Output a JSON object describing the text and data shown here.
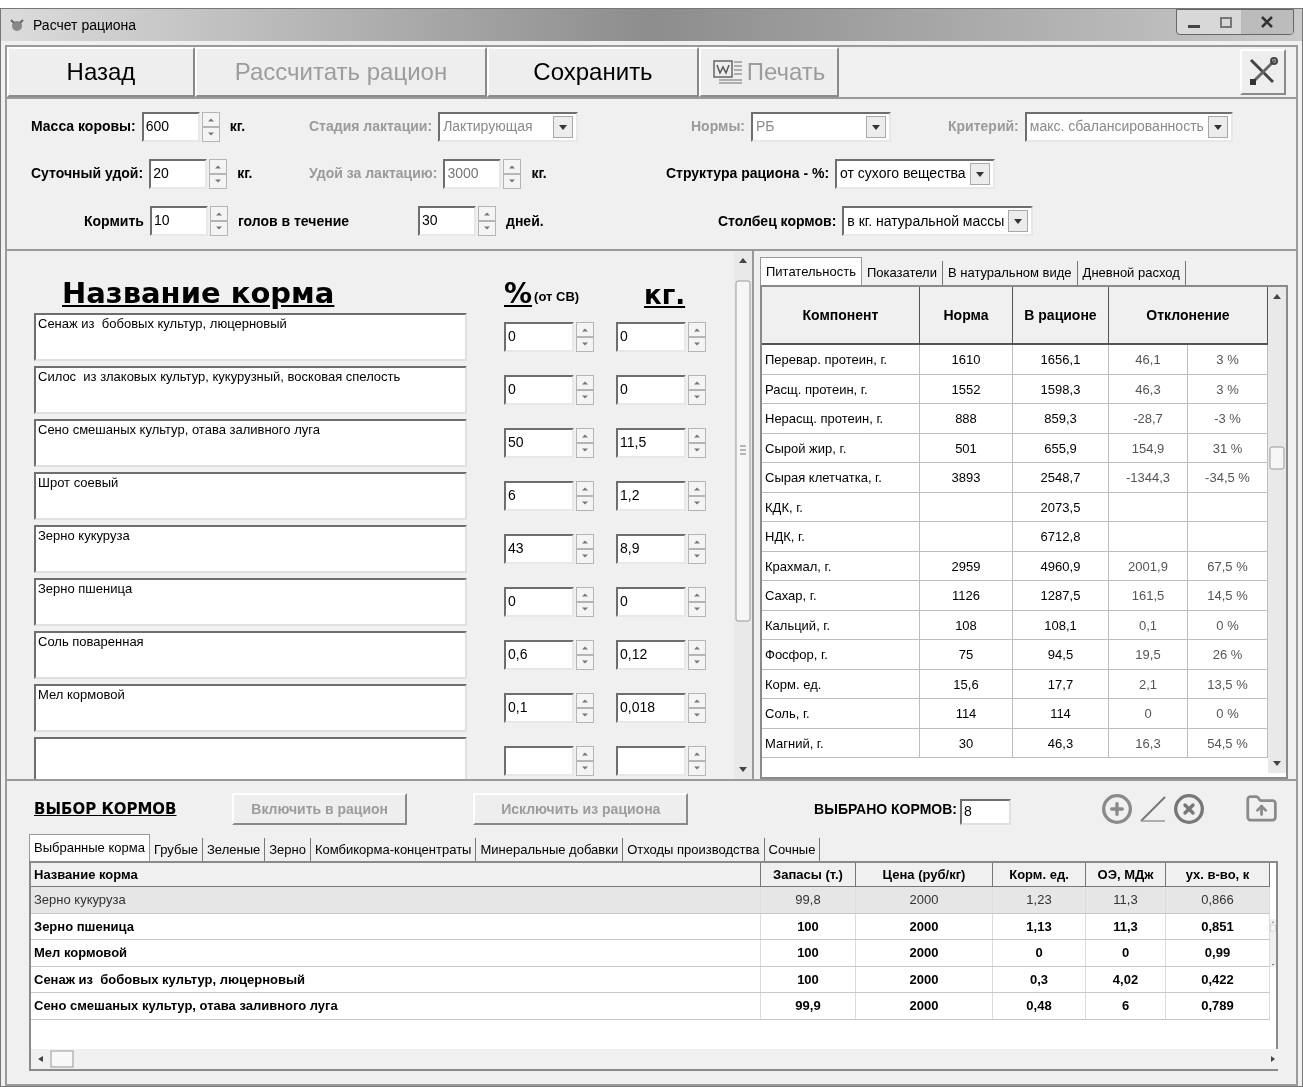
{
  "window": {
    "title": "Расчет рациона"
  },
  "toolbar": [
    {
      "label": "Назад",
      "disabled": false,
      "kind": "text"
    },
    {
      "label": "Рассчитать рацион",
      "disabled": true,
      "kind": "text"
    },
    {
      "label": "Сохранить",
      "disabled": false,
      "kind": "text"
    },
    {
      "label": "Печать",
      "disabled": true,
      "kind": "document"
    }
  ],
  "params": [
    [
      {
        "kind": "spin",
        "label": "Масса коровы:",
        "value": "600",
        "unit": "кг.",
        "disabled": false
      },
      {
        "kind": "combo",
        "label": "Стадия лактации:",
        "value": "Лактирующая",
        "disabled": true
      },
      {
        "kind": "combo",
        "label": "Нормы:",
        "value": "РБ",
        "disabled": true
      },
      {
        "kind": "combo",
        "label": "Критерий:",
        "value": "макс. сбалансированность",
        "disabled": true
      }
    ],
    [
      {
        "kind": "spin",
        "label": "Суточный удой:",
        "value": "20",
        "unit": "кг.",
        "disabled": false
      },
      {
        "kind": "spin",
        "label": "Удой за лактацию:",
        "value": "3000",
        "unit": "кг.",
        "disabled": true
      },
      {
        "kind": "combo",
        "label": "Структура рациона - %:",
        "value": "от сухого вещества",
        "disabled": false
      }
    ],
    [
      {
        "kind": "spin",
        "label": "Кормить",
        "value": "10",
        "unit": "голов в течение",
        "disabled": false
      },
      {
        "kind": "spin",
        "value": "30",
        "unit": "дней.",
        "disabled": false
      },
      {
        "kind": "combo",
        "label": "Столбец кормов:",
        "value": "в кг. натуральной массы",
        "disabled": false
      }
    ]
  ],
  "ration": {
    "name_heading": "Название корма",
    "pct_heading": "%",
    "pct_note": "(от СВ)",
    "kg_heading": "кг.",
    "rows": [
      {
        "kind": "feed",
        "name": "Сенаж из  бобовых культур, люцерновый",
        "pct": "0",
        "kg": "0"
      },
      {
        "kind": "feed",
        "name": "Силос  из злаковых культур, кукурузный, восковая спелость",
        "pct": "0",
        "kg": "0"
      },
      {
        "kind": "feed",
        "name": "Сено смешаных культур, отава заливного луга",
        "pct": "50",
        "kg": "11,5"
      },
      {
        "kind": "feed",
        "name": "Шрот соевый",
        "pct": "6",
        "kg": "1,2"
      },
      {
        "kind": "feed",
        "name": "Зерно кукуруза",
        "pct": "43",
        "kg": "8,9"
      },
      {
        "kind": "feed",
        "name": "Зерно пшеница",
        "pct": "0",
        "kg": "0"
      },
      {
        "kind": "feed",
        "name": "Соль поваренная",
        "pct": "0,6",
        "kg": "0,12"
      },
      {
        "kind": "feed",
        "name": "Мел кормовой",
        "pct": "0,1",
        "kg": "0,018"
      },
      {
        "kind": "empty"
      }
    ]
  },
  "analysis": {
    "tabs": [
      {
        "label": "Питательность",
        "selected": true
      },
      {
        "label": "Показатели",
        "selected": false
      },
      {
        "label": "В натуральном виде",
        "selected": false
      },
      {
        "label": "Дневной расход",
        "selected": false
      }
    ],
    "columns": [
      "Компонент",
      "Норма",
      "В рационе",
      "Отклонение"
    ],
    "rows": [
      {
        "component": "Перевар. протеин, г.",
        "norm": "1610",
        "in_ration": "1656,1",
        "deviation": "46,1",
        "deviation_pct": "3 %"
      },
      {
        "component": "Расщ. протеин, г.",
        "norm": "1552",
        "in_ration": "1598,3",
        "deviation": "46,3",
        "deviation_pct": "3 %"
      },
      {
        "component": "Нерасщ. протеин, г.",
        "norm": "888",
        "in_ration": "859,3",
        "deviation": "-28,7",
        "deviation_pct": "-3 %"
      },
      {
        "component": "Сырой жир, г.",
        "norm": "501",
        "in_ration": "655,9",
        "deviation": "154,9",
        "deviation_pct": "31 %"
      },
      {
        "component": "Сырая клетчатка, г.",
        "norm": "3893",
        "in_ration": "2548,7",
        "deviation": "-1344,3",
        "deviation_pct": "-34,5 %"
      },
      {
        "component": "КДК, г.",
        "in_ration": "2073,5"
      },
      {
        "component": "НДК, г.",
        "in_ration": "6712,8"
      },
      {
        "component": "Крахмал, г.",
        "norm": "2959",
        "in_ration": "4960,9",
        "deviation": "2001,9",
        "deviation_pct": "67,5 %"
      },
      {
        "component": "Сахар, г.",
        "norm": "1126",
        "in_ration": "1287,5",
        "deviation": "161,5",
        "deviation_pct": "14,5 %"
      },
      {
        "component": "Кальций, г.",
        "norm": "108",
        "in_ration": "108,1",
        "deviation": "0,1",
        "deviation_pct": "0 %"
      },
      {
        "component": "Фосфор, г.",
        "norm": "75",
        "in_ration": "94,5",
        "deviation": "19,5",
        "deviation_pct": "26 %"
      },
      {
        "component": "Корм. ед.",
        "norm": "15,6",
        "in_ration": "17,7",
        "deviation": "2,1",
        "deviation_pct": "13,5 %"
      },
      {
        "component": "Соль, г.",
        "norm": "114",
        "in_ration": "114",
        "deviation": "0",
        "deviation_pct": "0 %"
      },
      {
        "component": "Магний, г.",
        "norm": "30",
        "in_ration": "46,3",
        "deviation": "16,3",
        "deviation_pct": "54,5 %"
      }
    ]
  },
  "selection": {
    "title": "ВЫБОР КОРМОВ",
    "buttons": [
      {
        "label": "Включить в рацион",
        "disabled": true
      },
      {
        "label": "Исключить из рациона",
        "disabled": true
      }
    ],
    "count_label": "ВЫБРАНО КОРМОВ:",
    "count": "8",
    "tabs": [
      {
        "label": "Выбранные корма",
        "selected": true
      },
      {
        "label": "Грубые",
        "selected": false
      },
      {
        "label": "Зеленые",
        "selected": false
      },
      {
        "label": "Зерно",
        "selected": false
      },
      {
        "label": "Комбикорма-концентраты",
        "selected": false
      },
      {
        "label": "Минеральные добавки",
        "selected": false
      },
      {
        "label": "Отходы производства",
        "selected": false
      },
      {
        "label": "Сочные",
        "selected": false
      }
    ],
    "columns": [
      "Название корма",
      "Запасы (т.)",
      "Цена (руб/кг)",
      "Корм. ед.",
      "ОЭ, МДж",
      "ух. в-во, к"
    ],
    "rows": [
      {
        "selected": true,
        "cells": [
          "Зерно кукуруза",
          "99,8",
          "2000",
          "1,23",
          "11,3",
          "0,866"
        ]
      },
      {
        "selected": false,
        "cells": [
          "Зерно пшеница",
          "100",
          "2000",
          "1,13",
          "11,3",
          "0,851"
        ]
      },
      {
        "selected": false,
        "cells": [
          "Мел кормовой",
          "100",
          "2000",
          "0",
          "0",
          "0,99"
        ]
      },
      {
        "selected": false,
        "cells": [
          "Сенаж из  бобовых культур, люцерновый",
          "100",
          "2000",
          "0,3",
          "4,02",
          "0,422"
        ]
      },
      {
        "selected": false,
        "cells": [
          "Сено смешаных культур, отава заливного луга",
          "99,9",
          "2000",
          "0,48",
          "6",
          "0,789"
        ]
      }
    ]
  }
}
